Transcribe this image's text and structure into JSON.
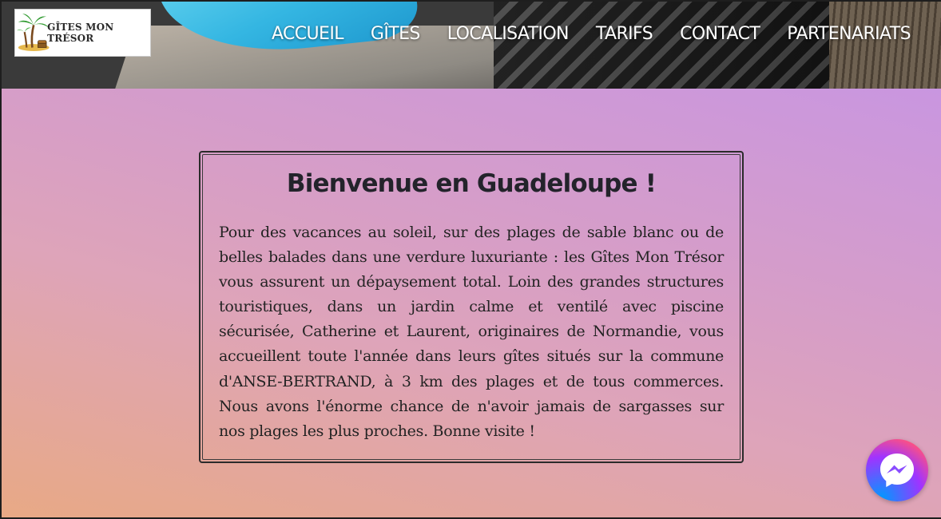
{
  "brand": {
    "logo_text": "GÎTES MON TRÉSOR"
  },
  "nav": [
    {
      "label": "ACCUEIL"
    },
    {
      "label": "GÎTES"
    },
    {
      "label": "LOCALISATION"
    },
    {
      "label": "TARIFS"
    },
    {
      "label": "CONTACT"
    },
    {
      "label": "PARTENARIATS"
    }
  ],
  "welcome": {
    "title": "Bienvenue en Guadeloupe !",
    "text": "Pour des vacances au soleil, sur des plages de sable blanc ou de belles balades dans une verdure luxuriante : les Gîtes Mon Trésor vous assurent un dépaysement total. Loin des grandes structures touristiques, dans un jardin calme et ventilé avec piscine sécurisée, Catherine et Laurent, originaires de Normandie, vous accueillent toute l'année dans leurs gîtes situés sur la commune d'ANSE-BERTRAND, à 3 km des plages et de tous commerces. Nous avons l'énorme chance de n'avoir jamais de sargasses sur nos plages les plus proches. Bonne visite !"
  },
  "icons": {
    "chat": "messenger-icon",
    "logo": "palm-tree-treasure-icon"
  },
  "colors": {
    "nav_text": "#ffffff",
    "title": "#23232b",
    "gradient_start": "#e8a985",
    "gradient_end": "#c996e0"
  }
}
